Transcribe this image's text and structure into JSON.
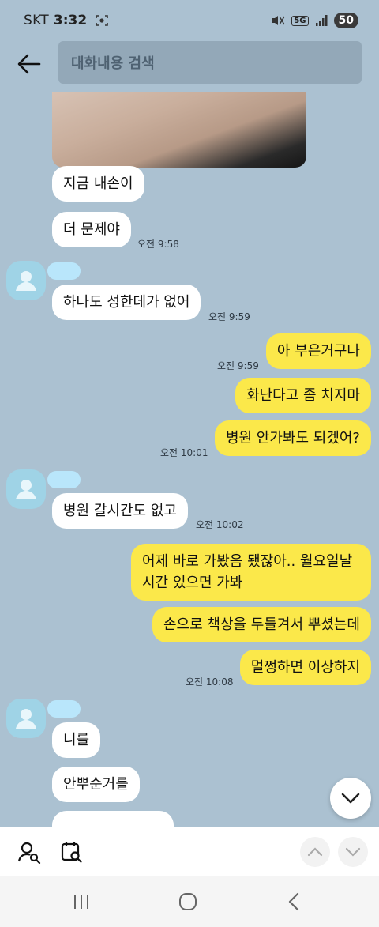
{
  "status_bar": {
    "carrier": "SKT",
    "time": "3:32",
    "network": "5G",
    "battery": "50"
  },
  "search": {
    "placeholder": "대화내용 검색"
  },
  "messages": {
    "m1": "지금 내손이",
    "m2": "더 문제야",
    "t2": "오전 9:58",
    "m3": "하나도 성한데가 없어",
    "t3": "오전 9:59",
    "m4": "아 부은거구나",
    "t4": "오전 9:59",
    "m5": "화난다고 좀 치지마",
    "m6": "병원 안가봐도 되겠어?",
    "t6": "오전 10:01",
    "m7": "병원 갈시간도 없고",
    "t7": "오전 10:02",
    "m8_line1": "어제 바로 가봤음 됐잖아.. 월요일날",
    "m8_line2": "시간 있으면 가봐",
    "m9": "손으로 책상을 두들겨서 뿌셨는데",
    "m10": "멀쩡하면 이상하지",
    "t10": "오전 10:08",
    "m11": "니를",
    "m12": "안뿌순거를"
  },
  "colors": {
    "background": "#abc1d1",
    "incoming_bubble": "#ffffff",
    "outgoing_bubble": "#fbe84a"
  }
}
